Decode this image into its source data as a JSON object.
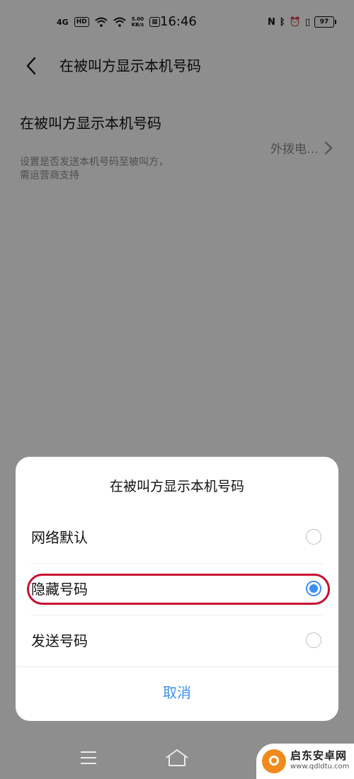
{
  "status_bar": {
    "network": "4G",
    "hd": "HD",
    "speed_value": "5.00",
    "speed_unit": "KB/s",
    "time": "16:46",
    "nfc": "N",
    "battery": "97"
  },
  "header": {
    "title": "在被叫方显示本机号码"
  },
  "setting": {
    "title": "在被叫方显示本机号码",
    "description": "设置是否发送本机号码至被叫方，需运营商支持",
    "value": "外拨电…"
  },
  "dialog": {
    "title": "在被叫方显示本机号码",
    "options": [
      {
        "label": "网络默认",
        "selected": false
      },
      {
        "label": "隐藏号码",
        "selected": true
      },
      {
        "label": "发送号码",
        "selected": false
      }
    ],
    "cancel_label": "取消"
  },
  "colors": {
    "accent": "#3d8ff0",
    "highlight": "#c8102e"
  },
  "watermark": {
    "name": "启东安卓网",
    "url": "www.qdldtu.com"
  }
}
